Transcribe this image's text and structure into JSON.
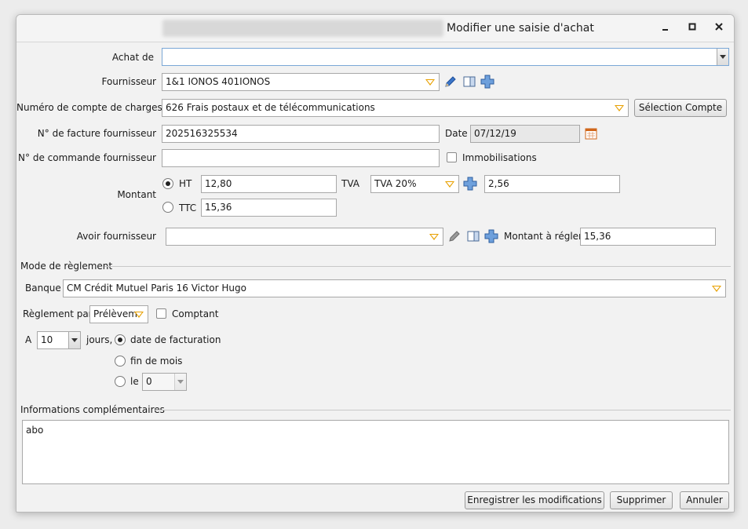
{
  "window": {
    "title": "Modifier une saisie d'achat"
  },
  "form": {
    "achat_de_label": "Achat de",
    "achat_de_value": "",
    "fournisseur_label": "Fournisseur",
    "fournisseur_value": "1&1 IONOS 401IONOS",
    "compte_label": "Numéro de compte de charges",
    "compte_value": "626 Frais postaux et de télécommunications",
    "selection_compte_label": "Sélection Compte",
    "facture_label": "N° de facture fournisseur",
    "facture_value": "202516325534",
    "date_label": "Date",
    "date_value": "07/12/19",
    "commande_label": "N° de commande fournisseur",
    "commande_value": "",
    "immobilisations_label": "Immobilisations",
    "montant_label": "Montant",
    "ht_label": "HT",
    "ht_value": "12,80",
    "tva_label": "TVA",
    "tva_value": "TVA 20%",
    "tva_amount": "2,56",
    "ttc_label": "TTC",
    "ttc_value": "15,36",
    "avoir_label": "Avoir fournisseur",
    "avoir_value": "",
    "montant_regler_label": "Montant à régler",
    "montant_regler_value": "15,36"
  },
  "reglement": {
    "section_label": "Mode de règlement",
    "banque_label": "Banque",
    "banque_value": "CM Crédit Mutuel Paris 16 Victor Hugo",
    "reglement_par_label": "Règlement par",
    "reglement_par_value": "Prélèvem",
    "comptant_label": "Comptant",
    "a_label": "A",
    "jours_value": "10",
    "jours_label": "jours,",
    "option_facturation": "date de facturation",
    "option_fin_mois": "fin de mois",
    "option_le": "le",
    "le_value": "0"
  },
  "infos": {
    "section_label": "Informations complémentaires",
    "text": "abo"
  },
  "footer": {
    "save_label": "Enregistrer les modifications",
    "delete_label": "Supprimer",
    "cancel_label": "Annuler"
  }
}
